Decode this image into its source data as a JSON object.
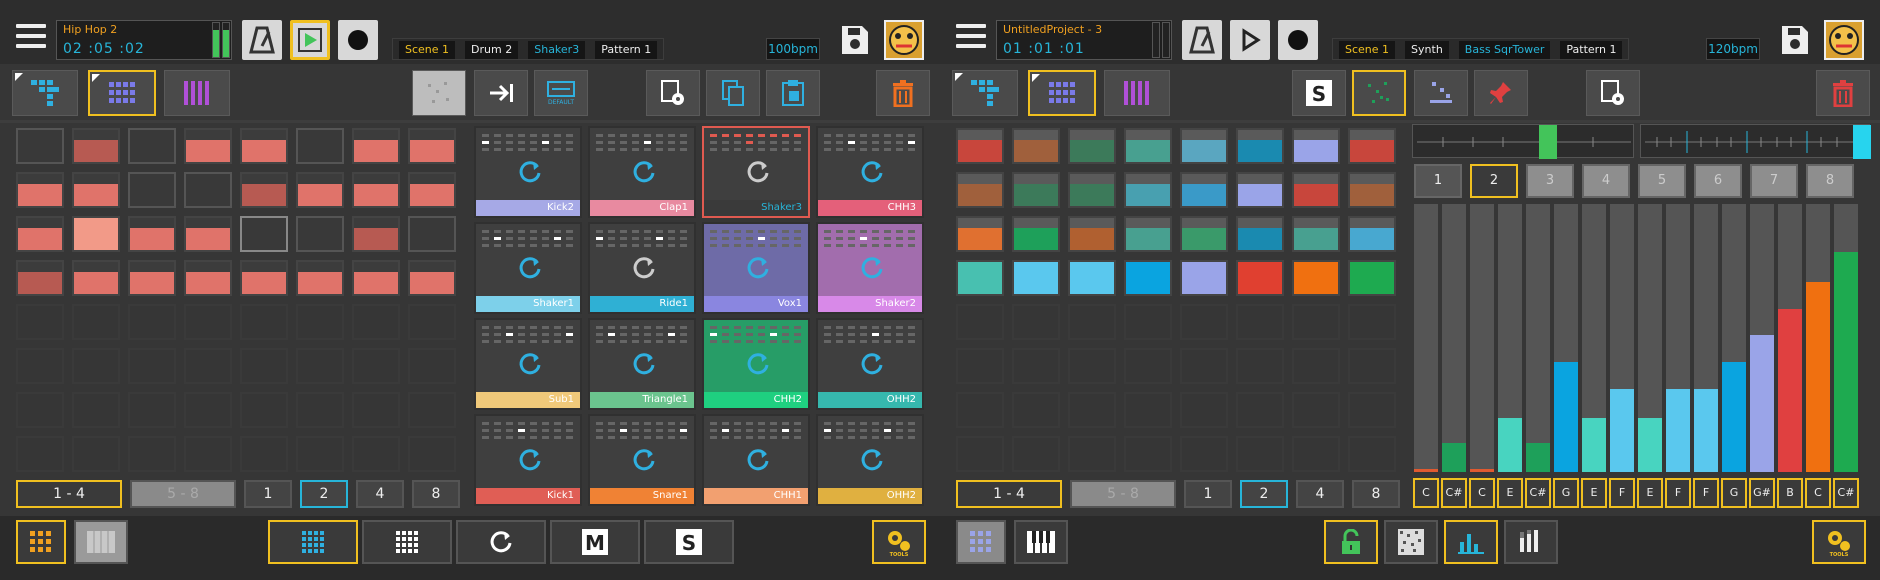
{
  "left": {
    "project": "Hip Hop 2",
    "time": [
      "02",
      ":05",
      ":02"
    ],
    "crumbs": [
      "Scene 1",
      "Drum 2",
      "Shaker3",
      "Pattern 1"
    ],
    "bpm": "100bpm",
    "page_buttons": [
      "1 - 4",
      "5 - 8",
      "1",
      "2",
      "4",
      "8"
    ],
    "pads": [
      "Kick2",
      "Clap1",
      "Shaker3",
      "CHH3",
      "Shaker1",
      "Ride1",
      "Vox1",
      "Shaker2",
      "Sub1",
      "Triangle1",
      "CHH2",
      "OHH2",
      "Kick1",
      "Snare1",
      "CHH1",
      "OHH2"
    ],
    "pad_colors": [
      "#a6a9e6",
      "#e88aa0",
      "#27b5d9",
      "#e4607a",
      "#7dd0ea",
      "#2fb0d4",
      "#8a86e0",
      "#d889e8",
      "#f0c97a",
      "#6bc48e",
      "#1fd080",
      "#36b8ae",
      "#e05e55",
      "#f08234",
      "#f2a070",
      "#e0b040"
    ]
  },
  "right": {
    "project": "UntitledProject - 3",
    "time": [
      "01",
      ":01",
      ":01"
    ],
    "crumbs": [
      "Scene 1",
      "Synth",
      "Bass SqrTower",
      "Pattern 1"
    ],
    "bpm": "120bpm",
    "page_buttons": [
      "1 - 4",
      "5 - 8",
      "1",
      "2",
      "4",
      "8"
    ],
    "step_numbers": [
      "1",
      "2",
      "3",
      "4",
      "5",
      "6",
      "7",
      "8"
    ],
    "notes": [
      "C",
      "C#",
      "C",
      "E",
      "C#",
      "G",
      "E",
      "F",
      "E",
      "F",
      "F",
      "G",
      "G#",
      "B",
      "C",
      "C#"
    ],
    "bar_levels": [
      0.01,
      0.11,
      0.01,
      0.2,
      0.11,
      0.41,
      0.2,
      0.31,
      0.2,
      0.31,
      0.31,
      0.41,
      0.51,
      0.61,
      0.71,
      0.82
    ],
    "bar_colors": [
      "#e05a30",
      "#1ea05a",
      "#e05a30",
      "#48d4c0",
      "#1ea05a",
      "#0aa4e0",
      "#48d4c0",
      "#5ac8ee",
      "#48d4c0",
      "#5ac8ee",
      "#5ac8ee",
      "#0aa4e0",
      "#9aa4e8",
      "#e04040",
      "#f07010",
      "#1eaa50"
    ]
  }
}
